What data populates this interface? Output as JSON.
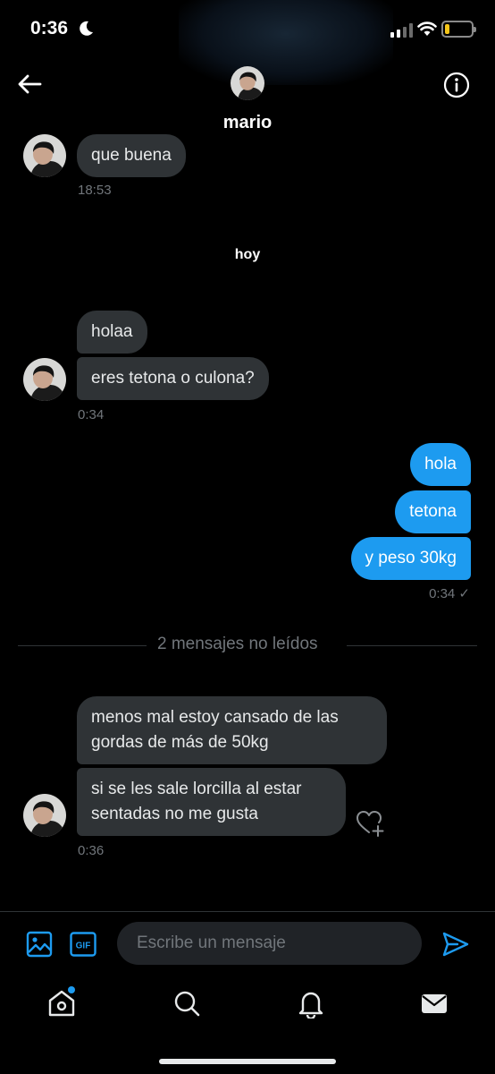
{
  "status_bar": {
    "time": "0:36"
  },
  "header": {
    "name": "mario"
  },
  "conversation": {
    "earlier": [
      {
        "text": "que buena"
      }
    ],
    "earlier_time": "18:53",
    "day_label": "hoy",
    "incoming_group_1": [
      {
        "text": "holaa"
      },
      {
        "text": "eres tetona o culona?"
      }
    ],
    "incoming_group_1_time": "0:34",
    "outgoing_group": [
      {
        "text": "hola"
      },
      {
        "text": "tetona"
      },
      {
        "text": "y peso 30kg"
      }
    ],
    "outgoing_time": "0:34 ✓",
    "unread_separator": "2 mensajes no leídos",
    "incoming_group_2": [
      {
        "text": "menos mal estoy cansado de las gordas de más de 50kg"
      },
      {
        "text": "si se les sale lorcilla al estar sentadas no me gusta"
      }
    ],
    "incoming_group_2_time": "0:36"
  },
  "composer": {
    "placeholder": "Escribe un mensaje"
  },
  "colors": {
    "accent": "#1d9bf0",
    "incoming_bubble": "#2f3336",
    "background": "#000000"
  },
  "icons": {
    "back": "arrow-left-icon",
    "info": "info-icon",
    "media": "image-icon",
    "gif": "gif-icon",
    "send": "send-icon",
    "react": "heart-plus-icon",
    "home": "home-icon",
    "search": "search-icon",
    "notifications": "bell-icon",
    "messages": "envelope-icon"
  }
}
